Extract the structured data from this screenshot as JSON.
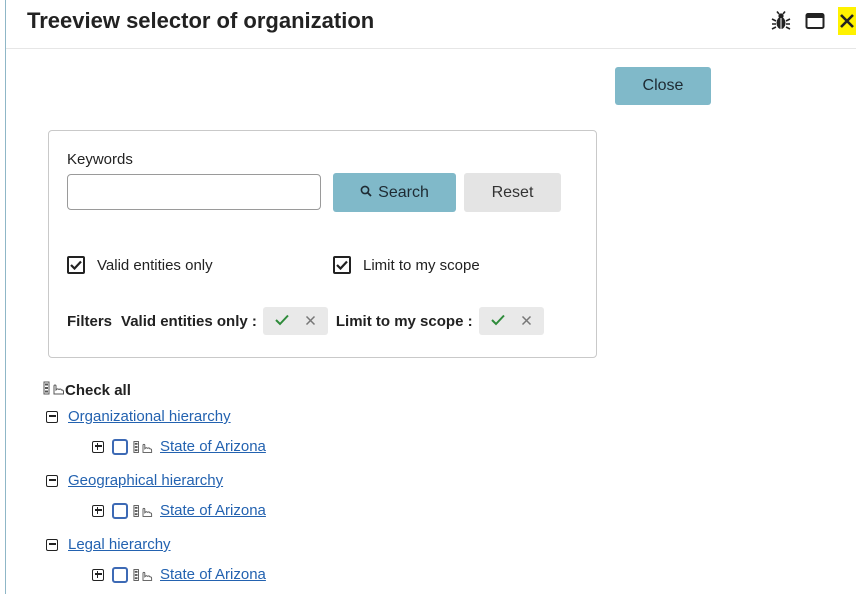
{
  "window": {
    "title": "Treeview selector of organization",
    "icons": [
      "bug-icon",
      "maximize-icon",
      "close-icon"
    ]
  },
  "close_label": "Close",
  "search_panel": {
    "keywords_label": "Keywords",
    "keywords_value": "",
    "search_label": "Search",
    "reset_label": "Reset",
    "valid_only_label": "Valid entities only",
    "valid_only_checked": true,
    "scope_label": "Limit to my scope",
    "scope_checked": true,
    "filters_label": "Filters",
    "filter_valid_label": "Valid entities only :",
    "filter_scope_label": "Limit to my scope :"
  },
  "tree": {
    "check_all": "Check all",
    "groups": [
      {
        "label": "Organizational hierarchy",
        "child": "State of Arizona"
      },
      {
        "label": "Geographical hierarchy",
        "child": "State of Arizona"
      },
      {
        "label": "Legal hierarchy",
        "child": "State of Arizona"
      }
    ]
  },
  "colors": {
    "primary_button": "#80b9c9",
    "secondary_button": "#e4e4e4",
    "link": "#2362b0",
    "check_green": "#2e8b3a",
    "close_highlight": "#fff200"
  }
}
